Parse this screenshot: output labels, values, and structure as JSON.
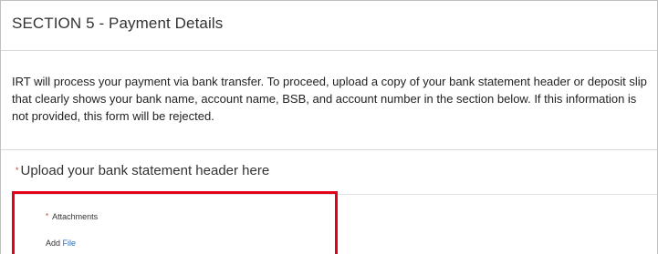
{
  "section": {
    "title": "SECTION 5 - Payment Details"
  },
  "instructions": {
    "text": "IRT will process your payment via bank transfer. To proceed, upload a copy of your bank statement header or deposit slip that clearly shows your bank name, account name, BSB, and account number in the section below. If this information is not provided, this form will be rejected."
  },
  "upload": {
    "required_marker": "*",
    "label": "Upload your bank statement header here"
  },
  "attachments": {
    "required_marker": "*",
    "label": "Attachments",
    "add_text": "Add",
    "file_link": "File"
  },
  "colors": {
    "highlight_border": "#e2001a",
    "required_star": "#c23934",
    "link": "#1a6fc4"
  }
}
